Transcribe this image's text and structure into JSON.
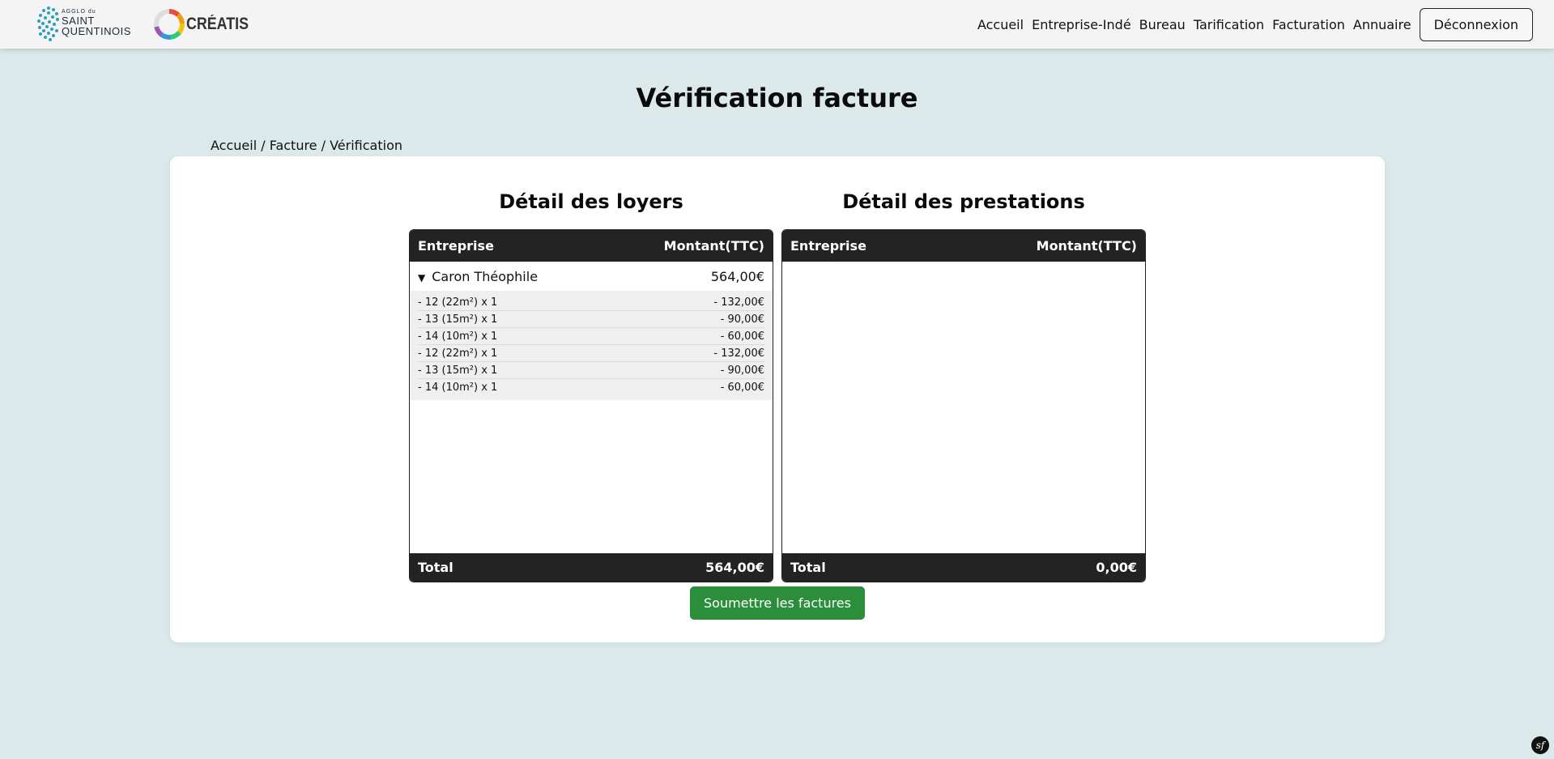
{
  "header": {
    "logo_agglo_small": "AGGLO du",
    "logo_agglo_line1": "SAINT",
    "logo_agglo_line2": "QUENTINOIS",
    "logo_creatis": "CRÉATIS",
    "nav": [
      "Accueil",
      "Entreprise-Indé",
      "Bureau",
      "Tarification",
      "Facturation",
      "Annuaire"
    ],
    "logout_label": "Déconnexion"
  },
  "page": {
    "title": "Vérification facture",
    "breadcrumb": [
      "Accueil",
      "Facture",
      "Vérification"
    ],
    "breadcrumb_sep": " / "
  },
  "loyers": {
    "title": "Détail des loyers",
    "col_company": "Entreprise",
    "col_amount": "Montant(TTC)",
    "company": {
      "toggle": "▼",
      "name": "Caron Théophile",
      "amount": "564,00€",
      "lines": [
        {
          "label": "- 12 (22m²) x 1",
          "amount": "- 132,00€"
        },
        {
          "label": "- 13 (15m²) x 1",
          "amount": "- 90,00€"
        },
        {
          "label": "- 14 (10m²) x 1",
          "amount": "- 60,00€"
        },
        {
          "label": "- 12 (22m²) x 1",
          "amount": "- 132,00€"
        },
        {
          "label": "- 13 (15m²) x 1",
          "amount": "- 90,00€"
        },
        {
          "label": "- 14 (10m²) x 1",
          "amount": "- 60,00€"
        }
      ]
    },
    "total_label": "Total",
    "total_value": "564,00€"
  },
  "prestations": {
    "title": "Détail des prestations",
    "col_company": "Entreprise",
    "col_amount": "Montant(TTC)",
    "total_label": "Total",
    "total_value": "0,00€"
  },
  "submit_label": "Soumettre les factures",
  "debug_icon": "sf"
}
